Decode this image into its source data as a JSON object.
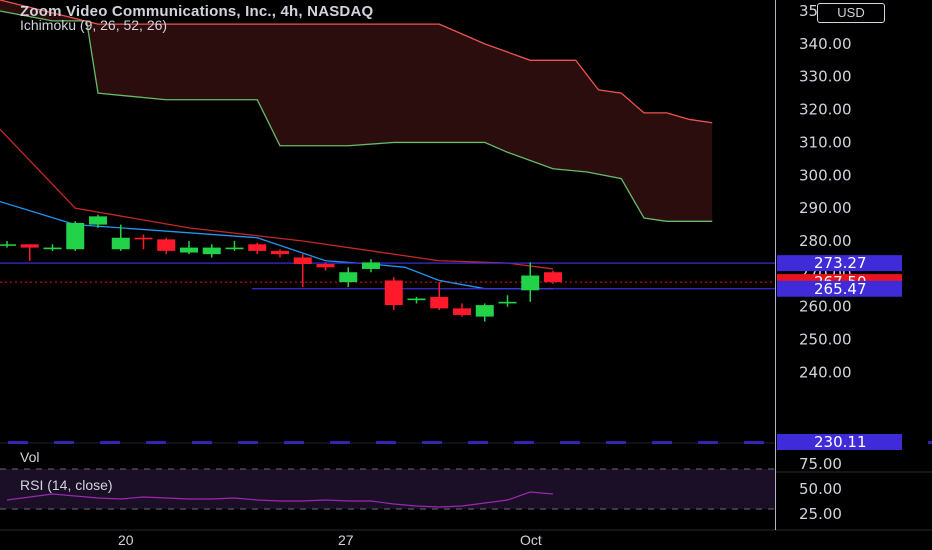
{
  "header": {
    "title": "Zoom Video Communications, Inc., 4h, NASDAQ",
    "indicator": "Ichimoku (9, 26, 52, 26)"
  },
  "currency": "USD",
  "panes": {
    "vol_label": "Vol",
    "rsi_label": "RSI (14, close)"
  },
  "colors": {
    "up": "#22d34a",
    "down": "#ff1a2b",
    "kijun": "#c62828",
    "tenkan": "#2196f3",
    "span_a": "#66bb6a",
    "span_b": "#ef5350",
    "cloud": "#2a0d0c",
    "level": "#3b2bd6",
    "badge_blue": "#3f2bd8",
    "badge_red": "#e8141f",
    "rsi": "#9c27b0",
    "rsi_band": "#1a0f26",
    "grid_text": "#d1d4dc"
  },
  "chart_data": [
    {
      "type": "candlestick",
      "title": "Zoom Video Communications, Inc., 4h, NASDAQ",
      "ylim": [
        230,
        363
      ],
      "y_ticks": [
        "350.00",
        "340.00",
        "330.00",
        "320.00",
        "310.00",
        "300.00",
        "290.00",
        "280.00",
        "270.00",
        "260.00",
        "250.00",
        "240.00"
      ],
      "x_ticks": [
        "20",
        "27",
        "Oct"
      ],
      "price_labels": [
        {
          "label": "273.27",
          "value": 273.27,
          "style": "blue"
        },
        {
          "label": "267.50",
          "value": 267.5,
          "style": "red"
        },
        {
          "label": "265.47",
          "value": 265.47,
          "style": "blue"
        },
        {
          "label": "230.11",
          "value": 230.11,
          "style": "blue"
        }
      ],
      "horizontal_levels": [
        273.27,
        265.47
      ],
      "last_price": 267.5,
      "candles": [
        {
          "o": 279,
          "h": 280,
          "l": 278,
          "c": 279
        },
        {
          "o": 279,
          "h": 279,
          "l": 274,
          "c": 278
        },
        {
          "o": 277.5,
          "h": 279,
          "l": 277,
          "c": 278
        },
        {
          "o": 277.5,
          "h": 286,
          "l": 277,
          "c": 285.5
        },
        {
          "o": 285,
          "h": 288,
          "l": 284,
          "c": 287.5
        },
        {
          "o": 277.5,
          "h": 285,
          "l": 277,
          "c": 281
        },
        {
          "o": 281,
          "h": 282,
          "l": 277.5,
          "c": 280.5
        },
        {
          "o": 280.5,
          "h": 281,
          "l": 276,
          "c": 277
        },
        {
          "o": 276.5,
          "h": 280,
          "l": 276,
          "c": 278
        },
        {
          "o": 276,
          "h": 279,
          "l": 275,
          "c": 278
        },
        {
          "o": 277.5,
          "h": 280,
          "l": 277,
          "c": 278
        },
        {
          "o": 279,
          "h": 279.5,
          "l": 276,
          "c": 277
        },
        {
          "o": 277,
          "h": 277.5,
          "l": 275,
          "c": 276
        },
        {
          "o": 275,
          "h": 276,
          "l": 266,
          "c": 273
        },
        {
          "o": 273,
          "h": 273.5,
          "l": 271,
          "c": 272
        },
        {
          "o": 267.5,
          "h": 272,
          "l": 266,
          "c": 270.5
        },
        {
          "o": 271.5,
          "h": 274.5,
          "l": 270.5,
          "c": 273.5
        },
        {
          "o": 268,
          "h": 269,
          "l": 259,
          "c": 260.5
        },
        {
          "o": 262,
          "h": 263,
          "l": 261,
          "c": 262.5
        },
        {
          "o": 263,
          "h": 267.5,
          "l": 259,
          "c": 259.5
        },
        {
          "o": 259.5,
          "h": 261,
          "l": 257,
          "c": 257.5
        },
        {
          "o": 257,
          "h": 261,
          "l": 255.5,
          "c": 260.5
        },
        {
          "o": 261,
          "h": 263.5,
          "l": 260,
          "c": 261.5
        },
        {
          "o": 265,
          "h": 273.5,
          "l": 261.5,
          "c": 269.5
        },
        {
          "o": 270.5,
          "h": 271,
          "l": 267,
          "c": 267.5
        }
      ],
      "series": [
        {
          "key": "kijun",
          "x": [
            -1,
            3,
            8,
            13,
            19,
            22,
            24
          ],
          "values": [
            314,
            290,
            284,
            280,
            274,
            273.3,
            271.5
          ]
        },
        {
          "key": "tenkan",
          "x": [
            -1,
            3,
            5,
            11,
            14,
            16,
            17.5,
            19,
            21,
            24
          ],
          "values": [
            292,
            285,
            284,
            281,
            274,
            273,
            272,
            268,
            265.5,
            265.5
          ]
        },
        {
          "key": "span_a",
          "x": [
            -1,
            2,
            3.5,
            4,
            7,
            11,
            12,
            15,
            17,
            21,
            22,
            24,
            25.5,
            27,
            28,
            29,
            31
          ],
          "values": [
            350,
            347,
            347,
            325,
            323,
            323,
            309,
            309,
            310,
            310,
            307,
            302,
            301,
            299,
            287,
            286,
            286
          ]
        },
        {
          "key": "span_b",
          "x": [
            -1,
            4,
            7,
            11,
            19,
            21,
            23,
            25,
            26,
            27,
            28,
            29,
            30,
            31
          ],
          "values": [
            363,
            346,
            346,
            346,
            346,
            340,
            335,
            335,
            326,
            325,
            319,
            319,
            317,
            316
          ]
        }
      ]
    },
    {
      "type": "line",
      "title": "RSI (14, close)",
      "ylim": [
        20,
        80
      ],
      "y_ticks": [
        "75.00",
        "50.00",
        "25.00"
      ],
      "band": [
        30,
        70
      ],
      "x": [
        0,
        1,
        2,
        3,
        4,
        5,
        6,
        7,
        8,
        9,
        10,
        11,
        12,
        13,
        14,
        15,
        16,
        17,
        18,
        19,
        20,
        21,
        22,
        23,
        24
      ],
      "values": [
        39,
        42,
        45,
        43,
        41,
        40,
        42,
        41,
        40,
        40,
        41,
        39,
        38,
        38,
        39,
        38,
        38,
        35,
        33,
        32,
        33,
        36,
        39,
        47,
        45
      ]
    }
  ]
}
